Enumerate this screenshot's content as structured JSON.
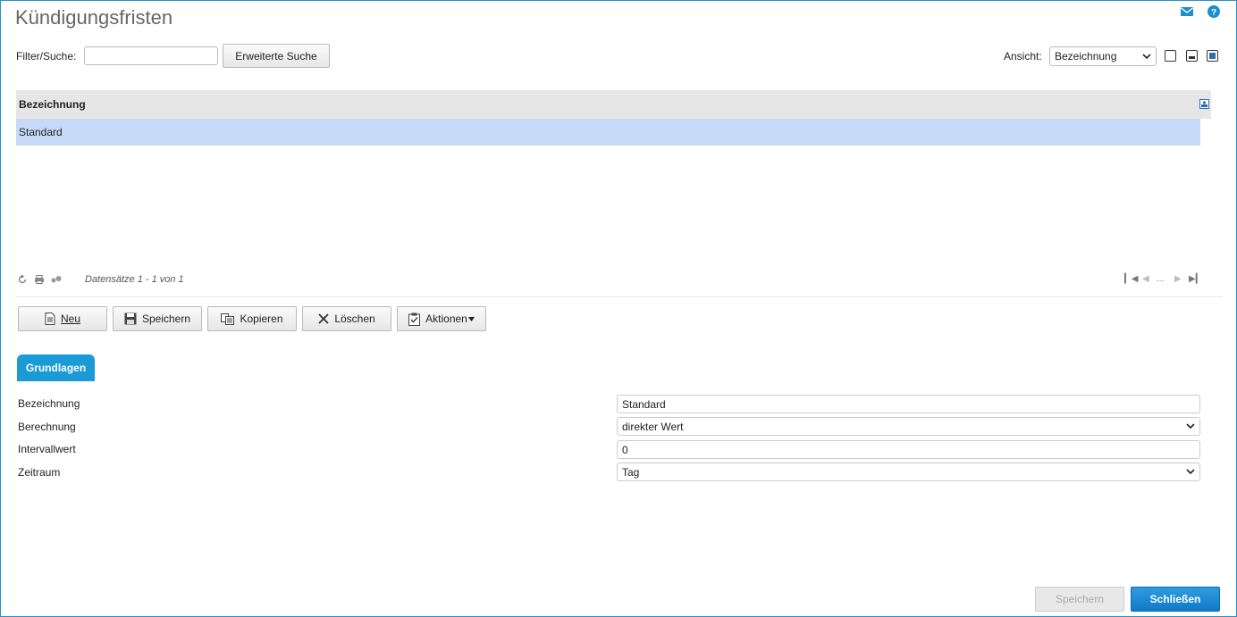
{
  "header": {
    "title": "Kündigungsfristen",
    "icons": [
      "mail-icon",
      "help-icon"
    ]
  },
  "filter": {
    "label": "Filter/Suche:",
    "value": "",
    "extended_search_label": "Erweiterte Suche"
  },
  "view": {
    "label": "Ansicht:",
    "selected": "Bezeichnung"
  },
  "grid": {
    "columns": [
      "Bezeichnung"
    ],
    "rows": [
      {
        "bezeichnung": "Standard"
      }
    ],
    "records_info": "Datensätze 1 - 1 von 1",
    "pager_ellipsis": "..."
  },
  "toolbar": {
    "new_label": "Neu",
    "save_label": "Speichern",
    "copy_label": "Kopieren",
    "delete_label": "Löschen",
    "actions_label": "Aktionen"
  },
  "tabs": [
    {
      "label": "Grundlagen",
      "active": true
    }
  ],
  "form": {
    "fields": [
      {
        "label": "Bezeichnung",
        "value": "Standard"
      },
      {
        "label": "Berechnung",
        "value": "direkter Wert"
      },
      {
        "label": "Intervallwert",
        "value": "0"
      },
      {
        "label": "Zeitraum",
        "value": "Tag"
      }
    ]
  },
  "footer": {
    "save_label": "Speichern",
    "close_label": "Schließen"
  },
  "colors": {
    "accent": "#1a9ad6",
    "selected_row": "#c6d9f7",
    "border": "#2a8fc8"
  }
}
